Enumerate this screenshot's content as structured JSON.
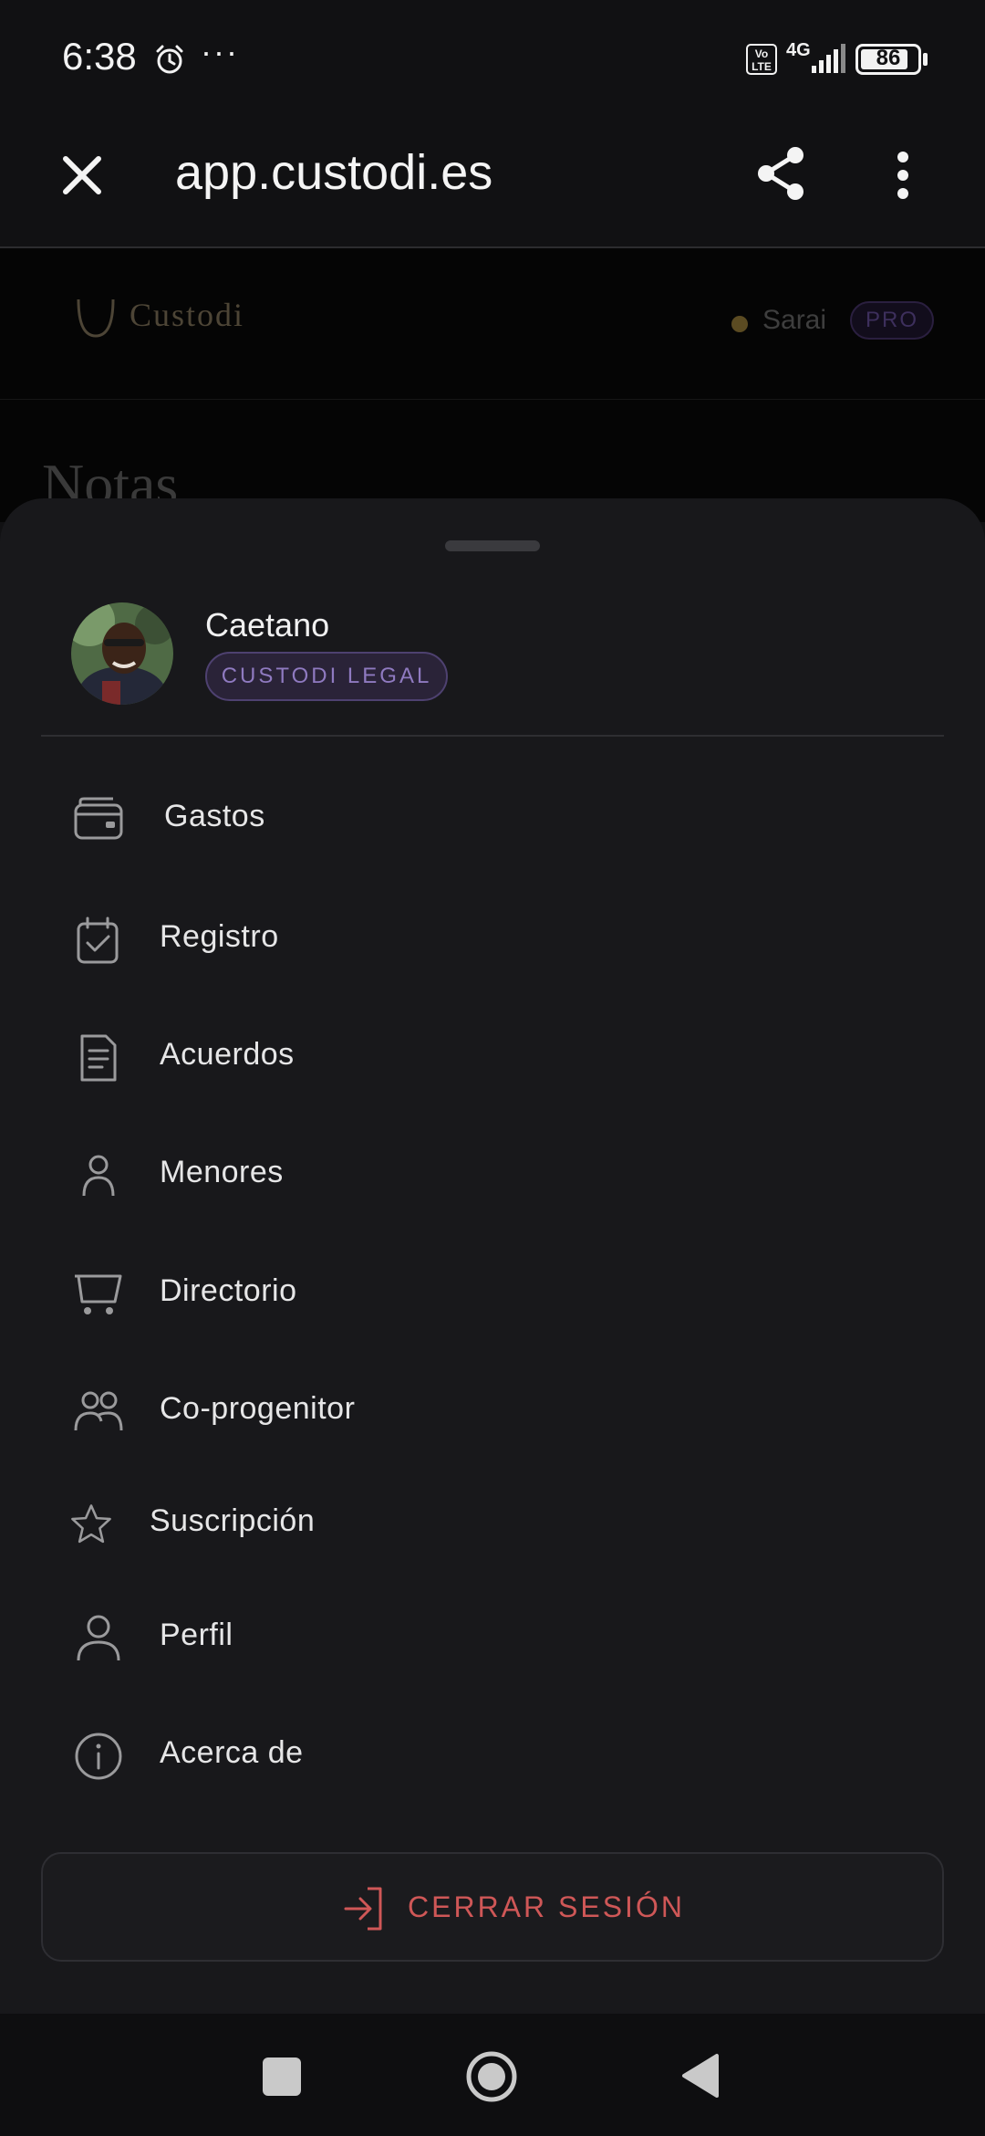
{
  "status_bar": {
    "time": "6:38",
    "more": "···",
    "volte": "Vo LTE",
    "network": "4G",
    "battery": "86",
    "battery_level": 0.86
  },
  "browser": {
    "url": "app.custodi.es"
  },
  "background_page": {
    "brand": "Custodi",
    "user_name": "Sarai",
    "plan_badge": "PRO",
    "page_title": "Notas"
  },
  "sheet": {
    "user": {
      "name": "Caetano",
      "badge": "CUSTODI LEGAL"
    },
    "menu": [
      {
        "label": "Gastos",
        "icon": "wallet-icon"
      },
      {
        "label": "Registro",
        "icon": "calendar-check-icon"
      },
      {
        "label": "Acuerdos",
        "icon": "document-icon"
      },
      {
        "label": "Menores",
        "icon": "person-icon"
      },
      {
        "label": "Directorio",
        "icon": "cart-icon"
      },
      {
        "label": "Co-progenitor",
        "icon": "people-icon"
      },
      {
        "label": "Suscripción",
        "icon": "star-icon"
      },
      {
        "label": "Perfil",
        "icon": "user-icon"
      },
      {
        "label": "Acerca de",
        "icon": "info-icon"
      }
    ],
    "logout_label": "CERRAR SESIÓN"
  },
  "colors": {
    "accent_badge": "#8f7ac0",
    "logout": "#cf5757",
    "sheet_bg": "#18181b"
  }
}
